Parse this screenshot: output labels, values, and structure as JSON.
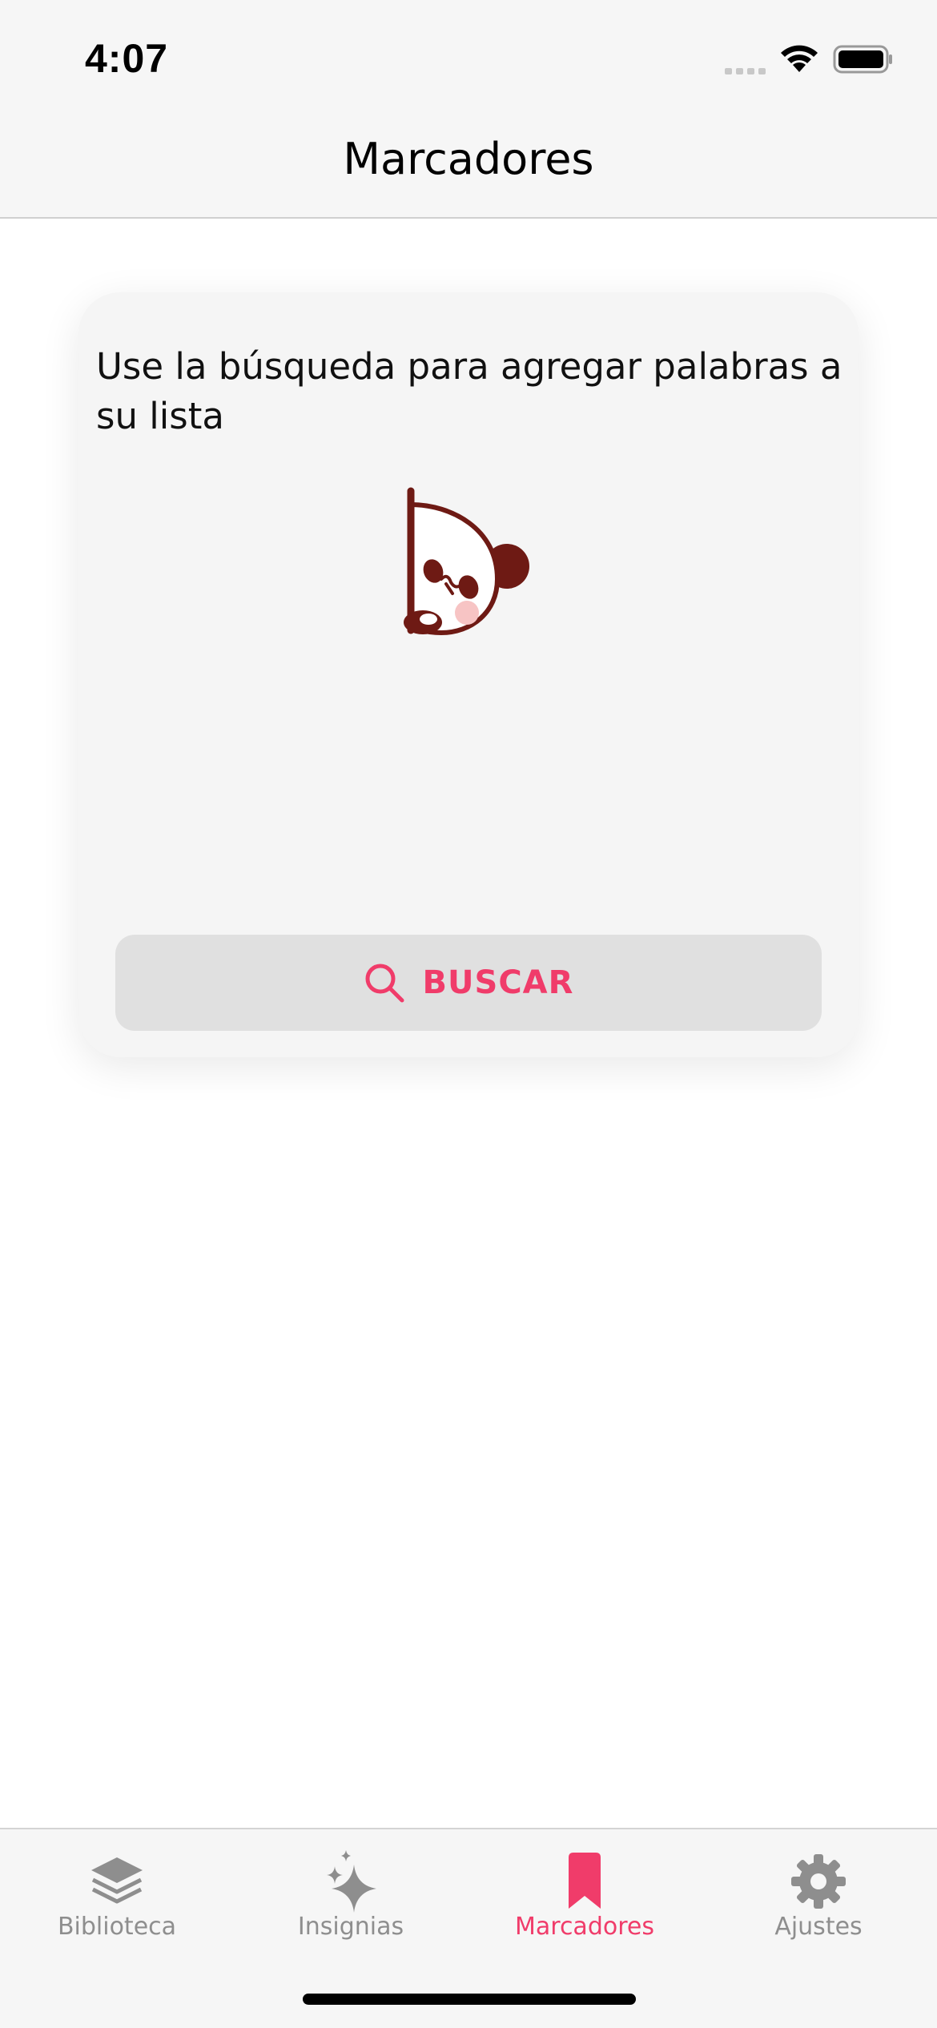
{
  "status_bar": {
    "time": "4:07",
    "icons": [
      "signal-dots-icon",
      "wifi-icon",
      "battery-icon"
    ]
  },
  "nav": {
    "title": "Marcadores"
  },
  "card": {
    "message": "Use la búsqueda para agregar palabras a su lista",
    "illustration": "panda-peeking-icon",
    "search_button": {
      "icon": "search-icon",
      "label": "BUSCAR"
    }
  },
  "tabs": [
    {
      "label": "Biblioteca",
      "icon": "layers-icon",
      "active": false
    },
    {
      "label": "Insignias",
      "icon": "sparkles-icon",
      "active": false
    },
    {
      "label": "Marcadores",
      "icon": "bookmark-icon",
      "active": true
    },
    {
      "label": "Ajustes",
      "icon": "gear-icon",
      "active": false
    }
  ],
  "colors": {
    "accent": "#f03c6a",
    "inactive": "#8e8e8e",
    "panda_brown": "#6e1a14",
    "bar_background": "#f6f6f6",
    "card_background": "#f5f5f5",
    "button_background": "#e0e0e0"
  }
}
